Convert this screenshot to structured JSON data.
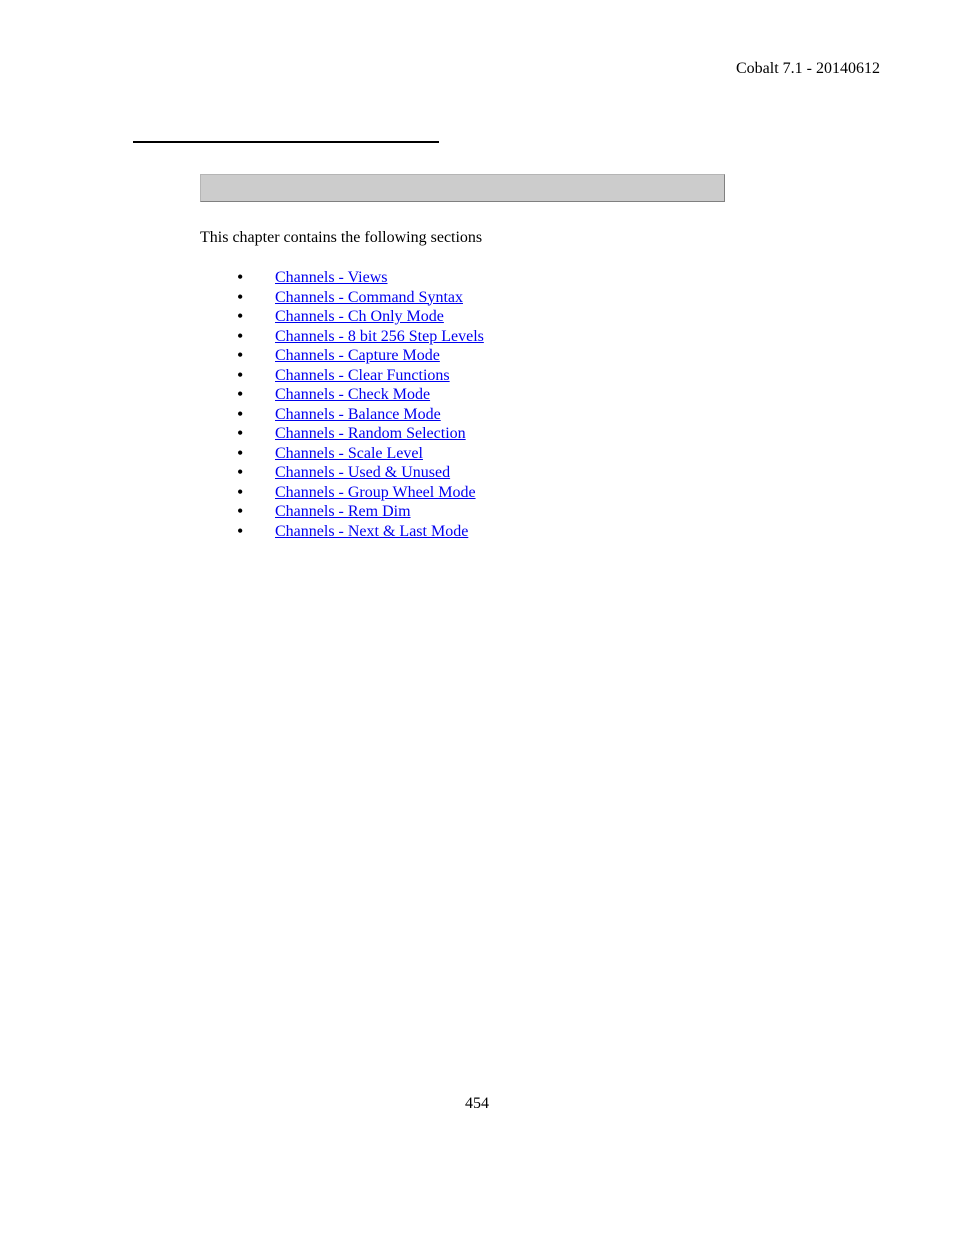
{
  "header": {
    "text": "Cobalt 7.1 - 20140612"
  },
  "intro": "This chapter contains the following sections",
  "links": [
    "Channels - Views",
    "Channels - Command Syntax",
    "Channels - Ch Only Mode",
    "Channels - 8 bit 256 Step Levels",
    "Channels - Capture Mode",
    "Channels - Clear Functions",
    "Channels - Check Mode",
    "Channels - Balance Mode",
    "Channels - Random Selection",
    "Channels - Scale Level",
    "Channels - Used & Unused",
    "Channels - Group Wheel Mode",
    "Channels - Rem Dim",
    "Channels - Next & Last Mode"
  ],
  "pageNumber": "454"
}
